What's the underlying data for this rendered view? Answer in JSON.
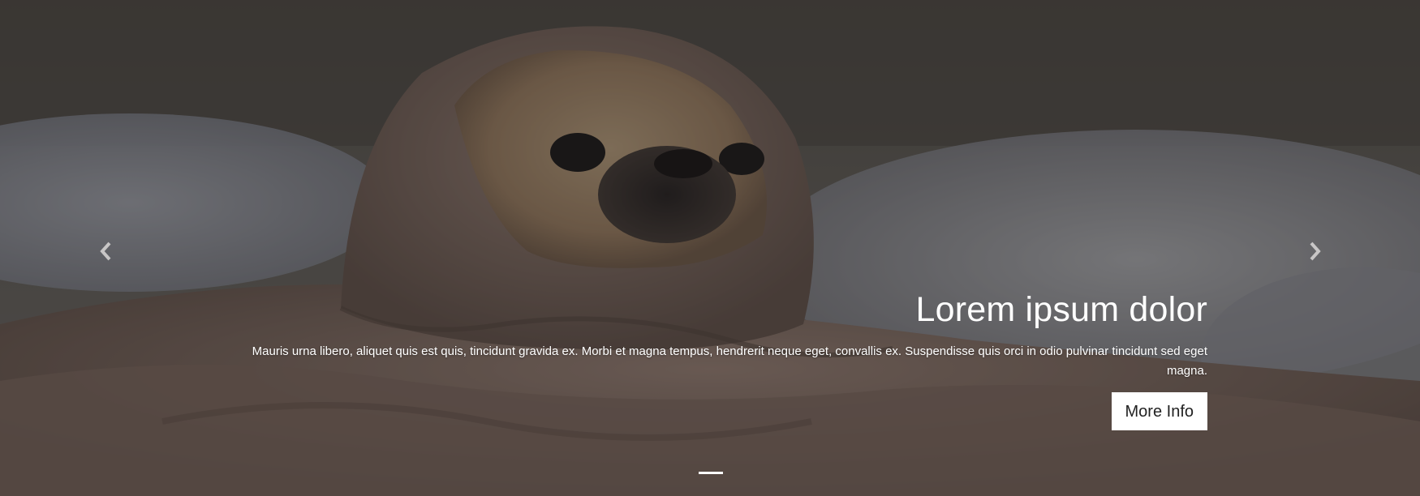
{
  "carousel": {
    "prev_icon": "chevron-left-icon",
    "next_icon": "chevron-right-icon",
    "slide": {
      "title": "Lorem ipsum dolor",
      "text": "Mauris urna libero, aliquet quis est quis, tincidunt gravida ex. Morbi et magna tempus, hendrerit neque eget, convallis ex. Suspendisse quis orci in odio pulvinar tincidunt sed eget magna.",
      "button_label": "More Info"
    },
    "indicators": [
      {
        "active": true
      }
    ],
    "colors": {
      "caption_text": "#ffffff",
      "button_bg": "#ffffff",
      "button_text": "#222222"
    }
  }
}
